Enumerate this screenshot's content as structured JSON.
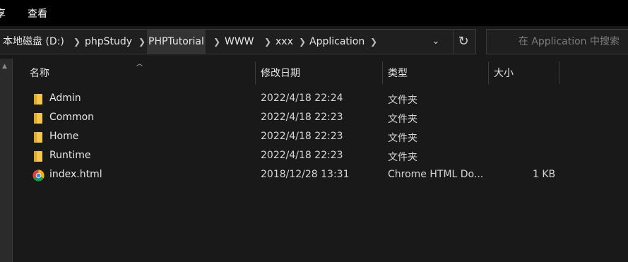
{
  "ribbon": {
    "partial_tab": "享",
    "view_tab": "查看"
  },
  "address": {
    "crumbs": [
      "本地磁盘 (D:)",
      "phpStudy",
      "PHPTutorial",
      "WWW",
      "xxx",
      "Application"
    ]
  },
  "search": {
    "placeholder": "在 Application 中搜索"
  },
  "columns": {
    "name": "名称",
    "modified": "修改日期",
    "type": "类型",
    "size": "大小"
  },
  "files": [
    {
      "name": "Admin",
      "modified": "2022/4/18 22:24",
      "type": "文件夹",
      "size": "",
      "icon": "folder-icon"
    },
    {
      "name": "Common",
      "modified": "2022/4/18 22:23",
      "type": "文件夹",
      "size": "",
      "icon": "folder-icon"
    },
    {
      "name": "Home",
      "modified": "2022/4/18 22:23",
      "type": "文件夹",
      "size": "",
      "icon": "folder-icon"
    },
    {
      "name": "Runtime",
      "modified": "2022/4/18 22:23",
      "type": "文件夹",
      "size": "",
      "icon": "folder-icon"
    },
    {
      "name": "index.html",
      "modified": "2018/12/28 13:31",
      "type": "Chrome HTML Do...",
      "size": "1 KB",
      "icon": "chrome-icon"
    }
  ],
  "colors": {
    "background": "#191919",
    "ribbon": "#000000",
    "folder": "#f3c74e",
    "text": "#e6e6e6"
  }
}
